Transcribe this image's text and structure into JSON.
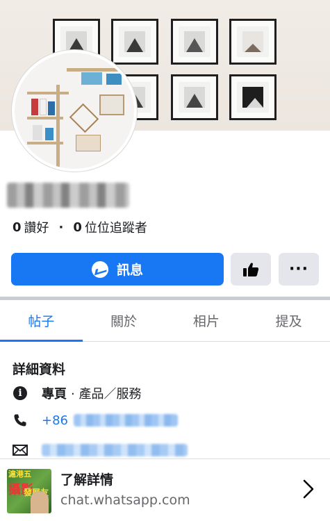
{
  "profile": {
    "name": "",
    "stats": {
      "likes_count": "0",
      "likes_label": "讚好",
      "separator": "·",
      "followers_count": "0",
      "followers_label": "位位追蹤者"
    }
  },
  "actions": {
    "message_label": "訊息",
    "like_icon": "thumbs-up-icon",
    "more_label": "···"
  },
  "tabs": [
    {
      "label": "帖子",
      "active": true
    },
    {
      "label": "關於",
      "active": false
    },
    {
      "label": "相片",
      "active": false
    },
    {
      "label": "提及",
      "active": false
    }
  ],
  "details": {
    "title": "詳細資料",
    "category_prefix": "專頁",
    "category_text": "· 產品／服務",
    "phone_prefix": "+86"
  },
  "ad": {
    "title": "了解詳情",
    "url": "chat.whatsapp.com",
    "thumb_text_1": "滬港五",
    "thumb_text_2": "攝影",
    "thumb_text_3": "發展友"
  },
  "colors": {
    "accent": "#1877f2",
    "tab_active": "#1877f2",
    "muted_button": "#e4e6eb"
  }
}
